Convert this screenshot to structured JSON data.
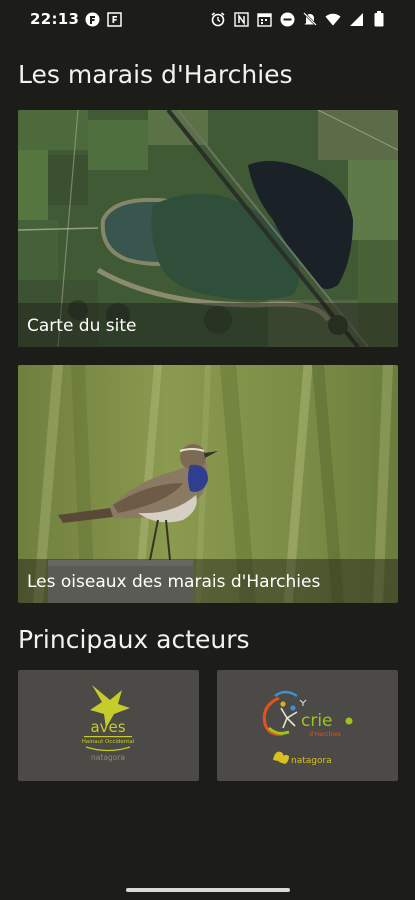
{
  "status_bar": {
    "time": "22:13",
    "left_icons": [
      "app-badge-icon",
      "f-box-icon"
    ],
    "right_icons": [
      "alarm-icon",
      "nfc-icon",
      "calendar-icon",
      "do-not-disturb-icon",
      "mute-icon",
      "wifi-icon",
      "signal-icon",
      "battery-icon"
    ]
  },
  "main": {
    "title": "Les marais d'Harchies",
    "cards": [
      {
        "label": "Carte du site",
        "image": "aerial-map-image"
      },
      {
        "label": "Les oiseaux des marais d'Harchies",
        "image": "bluethroat-bird-photo"
      }
    ]
  },
  "actors": {
    "title": "Principaux acteurs",
    "logos": [
      {
        "name": "aves",
        "subtitle": "Hainaut Occidental",
        "partner": "natagora"
      },
      {
        "name": "crie",
        "subtitle": "d'Harchies",
        "partner": "natagora"
      }
    ]
  },
  "colors": {
    "background": "#1c1d19",
    "logo_card": "#4b4a46",
    "aves_green": "#b8c222",
    "crie_green": "#9dc41c",
    "natagora_yellow": "#d8c020"
  }
}
